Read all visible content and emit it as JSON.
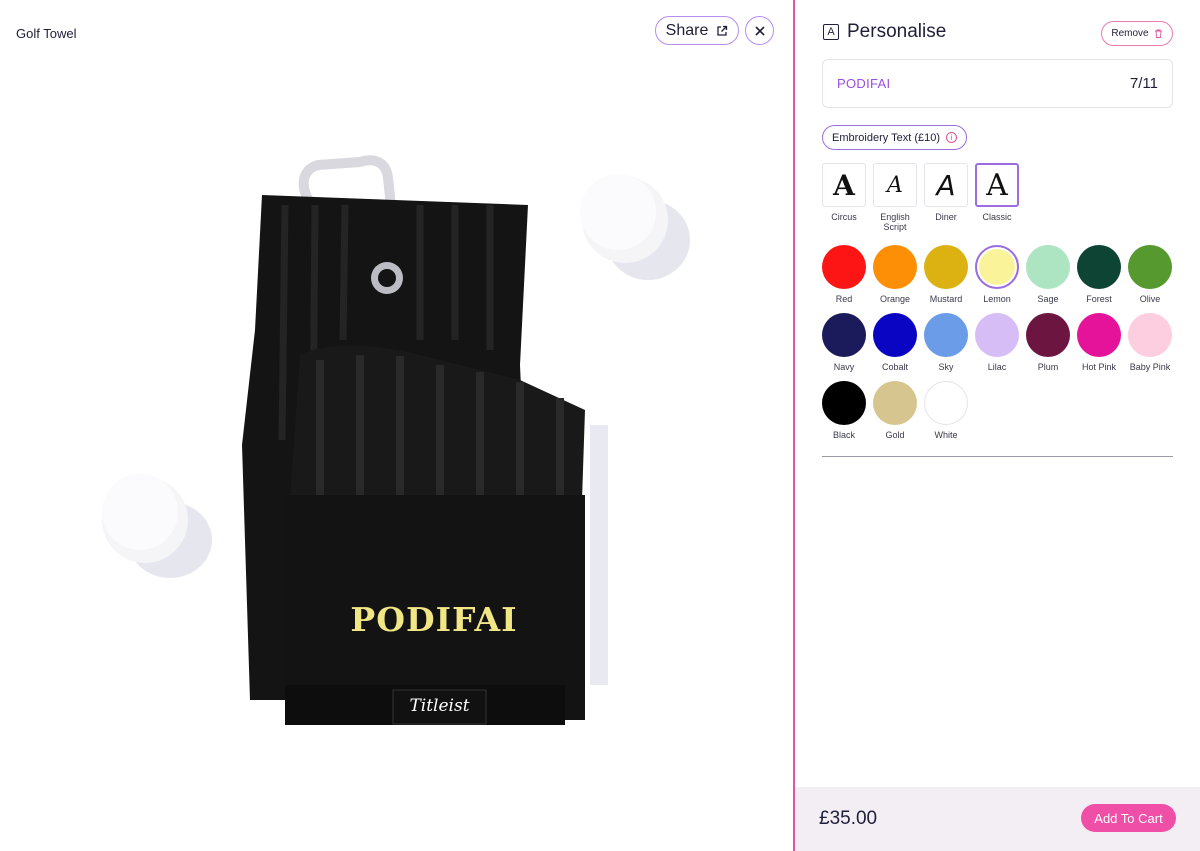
{
  "product": {
    "title": "Golf Towel",
    "share_label": "Share",
    "towel_text": "PODIFAI",
    "towel_brand": "Titleist"
  },
  "icons": {
    "share": "external-link-icon",
    "close": "close-icon",
    "personalise": "text-a-icon",
    "remove": "trash-icon",
    "info": "info-icon"
  },
  "panel": {
    "title": "Personalise",
    "remove_label": "Remove",
    "text_input": {
      "value": "PODIFAI",
      "count": "7/11"
    },
    "embroidery_label": "Embroidery Text (£10)",
    "fonts": [
      {
        "label": "Circus",
        "glyph": "A",
        "selected": false
      },
      {
        "label": "English Script",
        "glyph": "A",
        "selected": false
      },
      {
        "label": "Diner",
        "glyph": "A",
        "selected": false
      },
      {
        "label": "Classic",
        "glyph": "A",
        "selected": true
      }
    ],
    "colors": [
      {
        "label": "Red",
        "hex": "#fd1414"
      },
      {
        "label": "Orange",
        "hex": "#fd8f06"
      },
      {
        "label": "Mustard",
        "hex": "#dcb212"
      },
      {
        "label": "Lemon",
        "hex": "#fbf39a",
        "selected": true
      },
      {
        "label": "Sage",
        "hex": "#ade5c3"
      },
      {
        "label": "Forest",
        "hex": "#0e4434"
      },
      {
        "label": "Olive",
        "hex": "#55992f"
      },
      {
        "label": "Navy",
        "hex": "#1b1a5a"
      },
      {
        "label": "Cobalt",
        "hex": "#0905c2"
      },
      {
        "label": "Sky",
        "hex": "#6b9ce8"
      },
      {
        "label": "Lilac",
        "hex": "#d7bdf5"
      },
      {
        "label": "Plum",
        "hex": "#6c1540"
      },
      {
        "label": "Hot Pink",
        "hex": "#e5129a"
      },
      {
        "label": "Baby Pink",
        "hex": "#fdcde0"
      },
      {
        "label": "Black",
        "hex": "#000000"
      },
      {
        "label": "Gold",
        "hex": "#d6c58e"
      },
      {
        "label": "White",
        "hex": "#ffffff"
      }
    ]
  },
  "footer": {
    "price": "£35.00",
    "cart_label": "Add To Cart"
  },
  "theme": {
    "accent": "#9b6de0",
    "pink": "#ef4fa6",
    "embroidery_color": "#f1e685"
  }
}
